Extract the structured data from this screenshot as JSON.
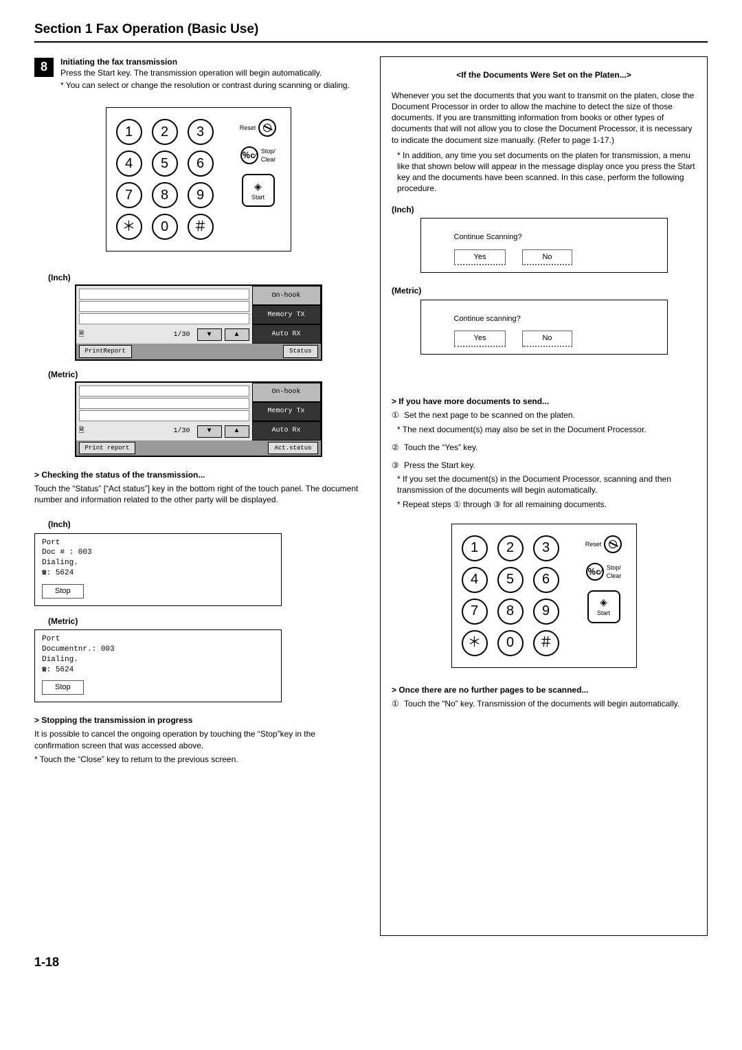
{
  "sectionTitle": "Section 1  Fax Operation (Basic Use)",
  "pageNum": "1-18",
  "step8": {
    "num": "8",
    "heading": "Initiating the fax transmission",
    "p1": "Press the Start key. The transmission operation will begin automatically.",
    "note1": "* You can select or change the resolution or contrast during scanning or dialing."
  },
  "keypad": {
    "keys": [
      "1",
      "2",
      "3",
      "4",
      "5",
      "6",
      "7",
      "8",
      "9",
      "＊",
      "0",
      "＃"
    ],
    "reset": "Reset",
    "stopclear_line1": "Stop/",
    "stopclear_line2": "Clear",
    "start": "Start",
    "stopclear_sym": "％c"
  },
  "leftScreens": {
    "inchLabel": "(Inch)",
    "metricLabel": "(Metric)",
    "pager": "1/30",
    "btn_onhook": "On-hook",
    "btn_memorytx_inch": "Memory TX",
    "btn_autorx_inch": "Auto RX",
    "btn_memorytx_metric": "Memory Tx",
    "btn_autorx_metric": "Auto Rx",
    "footer_print_inch": "PrintReport",
    "footer_status_inch": "Status",
    "footer_print_metric": "Print report",
    "footer_status_metric": "Act.status"
  },
  "checking": {
    "head": "> Checking the status of the transmission...",
    "body": "Touch the “Status” [“Act status”] key in the bottom right of the touch panel. The document number and information related to the other party will be displayed."
  },
  "portInch": {
    "label": "(Inch)",
    "l1": "Port",
    "l2": "Doc #   : 003",
    "l3": "Dialing.",
    "l4": "☎: 5624",
    "stop": "Stop"
  },
  "portMetric": {
    "label": "(Metric)",
    "l1": "Port",
    "l2": "Documentnr.: 003",
    "l3": "Dialing.",
    "l4": "☎: 5624",
    "stop": "Stop"
  },
  "stopping": {
    "head": "> Stopping the transmission in progress",
    "body": "It is possible to cancel the ongoing operation by touching the “Stop”key in the confirmation screen that was accessed above.",
    "note": "* Touch the “Close” key to return to the previous screen."
  },
  "right": {
    "title": "<If the Documents Were Set on the Platen...>",
    "p1": "Whenever you set the documents that you want to transmit on the platen, close the Document Processor in order to allow the machine to detect the size of those documents. If you are transmitting information from books or other types of documents that will not allow you to close the Document Processor, it is necessary to indicate the document size manually. (Refer to page 1-17.)",
    "p2": "* In addition, any time you set documents on the platen for transmission, a menu like that shown below will appear in the message display once you press the Start key and the documents have been scanned. In this case, perform the following procedure.",
    "inchLabel": "(Inch)",
    "metricLabel": "(Metric)",
    "prompt_inch": "Continue Scanning?",
    "prompt_metric": "Continue scanning?",
    "yes": "Yes",
    "no": "No",
    "moreHead": "> If you have more documents to send...",
    "more_1_mark": "①",
    "more_1": "Set the next page to be scanned on the platen.",
    "more_1n": "* The next document(s) may also be set in the Document Processor.",
    "more_2_mark": "②",
    "more_2": "Touch the “Yes” key.",
    "more_3_mark": "③",
    "more_3": "Press the Start key.",
    "more_3n1": "* If you set the document(s) in the Document Processor, scanning and then transmission of the documents will begin automatically.",
    "more_3n2": "* Repeat steps ① through ③ for all remaining documents.",
    "onceHead": "> Once there are no further pages to be scanned...",
    "once_1_mark": "①",
    "once_1": "Touch the “No” key. Transmission of the documents will begin automatically."
  }
}
